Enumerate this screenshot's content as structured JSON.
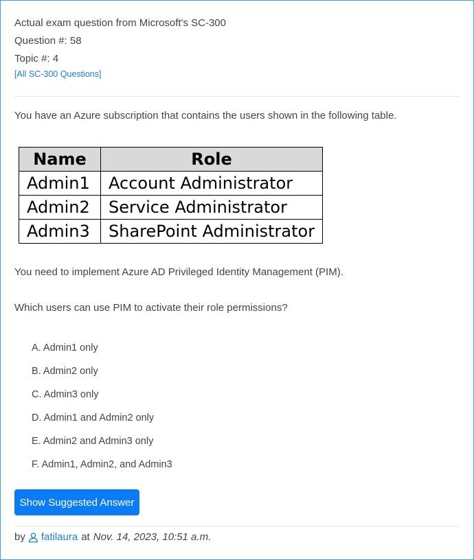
{
  "header": {
    "line1": "Actual exam question from Microsoft's SC-300",
    "line2": "Question #: 58",
    "line3": "Topic #: 4",
    "all_questions_link": "[All SC-300 Questions]"
  },
  "question": {
    "intro": "You have an Azure subscription that contains the users shown in the following table.",
    "table": {
      "headers": [
        "Name",
        "Role"
      ],
      "rows": [
        [
          "Admin1",
          "Account Administrator"
        ],
        [
          "Admin2",
          "Service Administrator"
        ],
        [
          "Admin3",
          "SharePoint Administrator"
        ]
      ]
    },
    "requirement": "You need to implement Azure AD Privileged Identity Management (PIM).",
    "prompt": "Which users can use PIM to activate their role permissions?"
  },
  "choices": [
    "A. Admin1 only",
    "B. Admin2 only",
    "C. Admin3 only",
    "D. Admin1 and Admin2 only",
    "E. Admin2 and Admin3 only",
    "F. Admin1, Admin2, and Admin3"
  ],
  "button": {
    "label": "Show Suggested Answer"
  },
  "footer": {
    "by": "by",
    "user_icon": "user-icon",
    "username": "fatilaura",
    "at": "at",
    "date": "Nov. 14, 2023, 10:51 a.m."
  },
  "colors": {
    "accent": "#0a7cf8",
    "link": "#1a82d8",
    "border": "#35a8e0",
    "table_header_bg": "#d9d9d9"
  }
}
